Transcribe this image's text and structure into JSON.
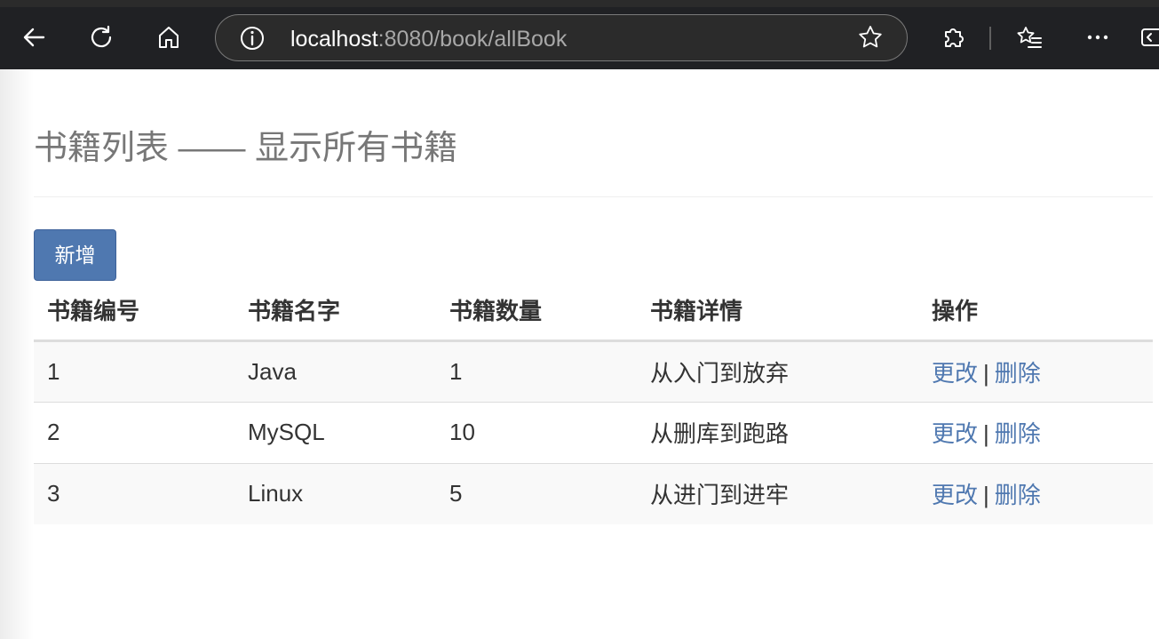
{
  "browser": {
    "url_host": "localhost",
    "url_path": ":8080/book/allBook"
  },
  "page": {
    "title": "书籍列表 —— 显示所有书籍",
    "add_button_label": "新增"
  },
  "table": {
    "headers": [
      "书籍编号",
      "书籍名字",
      "书籍数量",
      "书籍详情",
      "操作"
    ],
    "rows": [
      {
        "id": "1",
        "name": "Java",
        "count": "1",
        "detail": "从入门到放弃",
        "edit": "更改",
        "sep": "|",
        "delete": "删除"
      },
      {
        "id": "2",
        "name": "MySQL",
        "count": "10",
        "detail": "从删库到跑路",
        "edit": "更改",
        "sep": "|",
        "delete": "删除"
      },
      {
        "id": "3",
        "name": "Linux",
        "count": "5",
        "detail": "从进门到进牢",
        "edit": "更改",
        "sep": "|",
        "delete": "删除"
      }
    ]
  },
  "colors": {
    "accent": "#4f78b0",
    "browser_chrome": "#202124"
  }
}
